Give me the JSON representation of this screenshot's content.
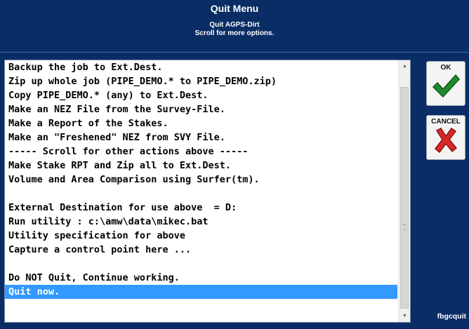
{
  "window": {
    "title": "Quit Menu",
    "subtitle_line1": "Quit AGPS-Dirt",
    "subtitle_line2": "Scroll for more options."
  },
  "menu": {
    "items": [
      "Backup the job to Ext.Dest.",
      "Zip up whole job (PIPE_DEMO.* to PIPE_DEMO.zip)",
      "Copy PIPE_DEMO.* (any) to Ext.Dest.",
      "Make an NEZ File from the Survey-File.",
      "Make a Report of the Stakes.",
      "Make an \"Freshened\" NEZ from SVY File.",
      "----- Scroll for other actions above -----",
      "Make Stake RPT and Zip all to Ext.Dest.",
      "Volume and Area Comparison using Surfer(tm).",
      "",
      "External Destination for use above  = D:",
      "Run utility : c:\\amw\\data\\mikec.bat",
      "Utility specification for above",
      "Capture a control point here ...",
      "",
      "Do NOT Quit, Continue working.",
      "Quit now."
    ],
    "selected_index": 16,
    "selected_color": "#3399ff"
  },
  "buttons": {
    "ok_label": "OK",
    "ok_icon": "checkmark-icon",
    "ok_color": "#1e8a2e",
    "cancel_label": "CANCEL",
    "cancel_icon": "x-icon",
    "cancel_color": "#d42a2a"
  },
  "footer": {
    "id_text": "fbgcquit"
  },
  "colors": {
    "background": "#0a2d66",
    "text": "#ffffff"
  }
}
